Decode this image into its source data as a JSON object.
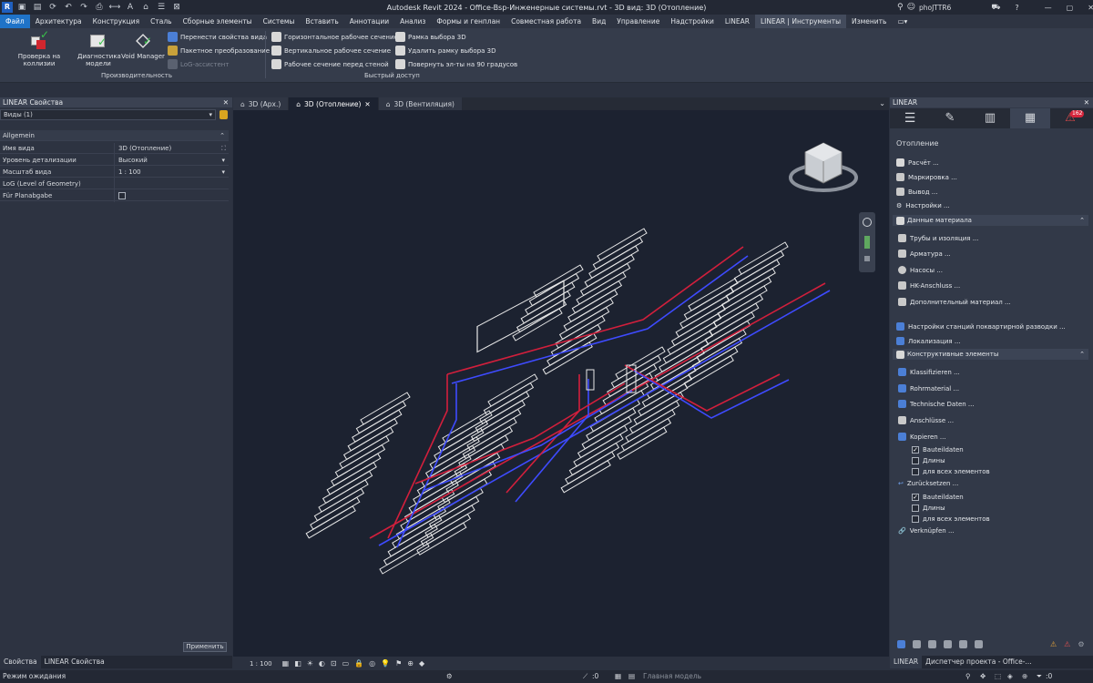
{
  "titlebar": {
    "title": "Autodesk Revit 2024 - Office-Bsp-Инженерные системы.rvt - 3D вид: 3D (Отопление)",
    "user": "phoJTTR6",
    "app_letter": "R"
  },
  "menu": [
    "Файл",
    "Архитектура",
    "Конструкция",
    "Сталь",
    "Сборные элементы",
    "Системы",
    "Вставить",
    "Аннотации",
    "Анализ",
    "Формы и генплан",
    "Совместная работа",
    "Вид",
    "Управление",
    "Надстройки",
    "LINEAR",
    "LINEAR | Инструменты",
    "Изменить"
  ],
  "ribbon": {
    "collision": "Проверка на коллизии",
    "diag1": "Диагностика",
    "diag2": "модели",
    "void": "Void Manager",
    "transfer": "Перенести свойства вида",
    "batch": "Пакетное преобразование",
    "log": "LoG-ассистент",
    "group1": "Производительность",
    "hsec": "Горизонтальное рабочее сечение",
    "vsec": "Вертикальное рабочее сечение",
    "wsec": "Рабочее сечение перед стеной",
    "frame": "Рамка выбора 3D",
    "delframe": "Удалить рамку выбора 3D",
    "rotate": "Повернуть эл-ты на 90 градусов",
    "group2": "Быстрый доступ"
  },
  "left": {
    "title": "LINEAR Свойства",
    "selector": "Виды (1)",
    "section": "Allgemein",
    "props": [
      {
        "k": "Имя вида",
        "v": "3D (Отопление)"
      },
      {
        "k": "Уровень детализации",
        "v": "Высокий"
      },
      {
        "k": "Масштаб вида",
        "v": "1 : 100"
      },
      {
        "k": "LoG (Level of Geometry)",
        "v": ""
      },
      {
        "k": "Für Planabgabe",
        "v": ""
      }
    ],
    "apply": "Применить",
    "tab1": "Свойства",
    "tab2": "LINEAR Свойства"
  },
  "tabs": [
    "3D (Арх.)",
    "3D (Отопление)",
    "3D (Вентиляция)"
  ],
  "viewbar": {
    "scale": "1 : 100"
  },
  "right": {
    "title": "LINEAR",
    "badge": "162",
    "heading": "Отопление",
    "items_top": [
      "Расчёт ...",
      "Маркировка ...",
      "Вывод ...",
      "Настройки ..."
    ],
    "sec_material": "Данные материала",
    "material_items": [
      "Трубы и изоляция ...",
      "Арматура ...",
      "Насосы ...",
      "HK-Anschluss ...",
      "Дополнительный материал ..."
    ],
    "stations": "Настройки станций поквартирной разводки ...",
    "local": "Локализация ...",
    "sec_construct": "Конструктивные элементы",
    "construct_items": [
      "Klassifizieren ...",
      "Rohrmaterial ...",
      "Technische Daten ...",
      "Anschlüsse ..."
    ],
    "copy": "Kopieren ...",
    "reset": "Zurücksetzen ...",
    "checks": [
      "Bauteildaten",
      "Длины",
      "для всех элементов"
    ],
    "link": "Verknüpfen ...",
    "bottom_tab1": "LINEAR",
    "bottom_tab2": "Диспетчер проекта - Office-..."
  },
  "status": {
    "left": "Режим ожидания",
    "mid1": ":0",
    "mid2": ":0",
    "model": "Главная модель",
    "right": ":0"
  },
  "colors": {
    "accent": "#1f73c8",
    "pipe_red": "#d21f3c",
    "pipe_blue": "#3e4bff",
    "geometry": "#e8e8e8",
    "viewport_bg": "#1c2230"
  }
}
